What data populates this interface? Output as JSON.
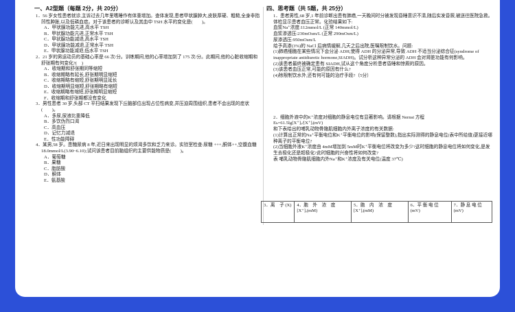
{
  "left": {
    "section_title": "一、A2型题（每题 2分，共 20分）",
    "questions": [
      {
        "stem": "1．56 岁女性患者就诊,主诉过去几年里嗜睡作有体重增加。查体发现,患者甲状腺肿大,皮肤厚硬、粗糙,全身非指凹性肿胀,以及低磷血症。对于该患者的诊断认及其血中 TSH 水平的变化是(　　)。",
        "options": [
          "A．甲状腺功能亢进,高水平 TSH",
          "B．甲状腺功能亢进,正常水平 TSH",
          "C．甲状腺功能减退,高水平 TSH",
          "D．甲状腺功能减退,正常水平 TSH",
          "E．甲状腺功能减退,低水平 TSH"
        ]
      },
      {
        "stem": "2．21 岁的男运动员的基础心率是 66 次/分。训练期间,他的心率增加到了 175 次/分。此期间,他的心脏收缩期和舒张期有何变化?(　)",
        "options": [
          "A．收缩期和舒张期同等缩短",
          "B．收缩期略有延长,舒张期明显缩短",
          "C．收缩期略有缩短,舒张期明显延长",
          "D．收缩期明显缩短,舒张期略有缩短",
          "E．收缩期略有缩短,舒张期明显缩短",
          "F．收缩期和舒张期都没有变化"
        ]
      },
      {
        "stem": "3．男性患者 30 岁,头部 CT 平扫结果发现下丘脑部位出现占位性病变,并压迫周围组织,患者不会出现的症状(　　)。",
        "options": [
          "A．多尿,尿液比重降低",
          "B．多饮伪烈口渴",
          "C．高血压",
          "D．记忆力减退",
          "E．性功能障碍"
        ]
      },
      {
        "stem": "4．某男,58 岁。患糖尿病 8 年,近日来出现明显的烦渴多饮和乏力来诊。实验室检查:尿糖 +++,酮体++,空腹血糖 18.0mmol/L(3.90~6.10);试问该患者目前脑组织的主要供能物质是(　　)。",
        "options": [
          "A．葡萄糖",
          "B．果糖",
          "C．脂肪酸",
          "D．酮体",
          "E．氨基酸"
        ]
      }
    ]
  },
  "right": {
    "section_title": "四、思考题（共 5题，共 25分）",
    "q1": [
      "1．患者男性,68 岁,1 年前诊断出患有肺癌,一天晚间时分被发现昏睡意识不清,随后实发昏厥,被送往医院急救。体检显示患者血压正常。化验结果如下:",
      "血浆Na⁺浓度:112mmol/L (正常 140mmol/L)",
      "血浆渗透压:230mOsm/L (正常 290mOsm/L)",
      "尿渗透压:950mOsm/L",
      "给予高渗(3%)的 NaCl 后病情缓解,几天之后出院,医嘱限制饮水。问题:",
      "(1)肺癌细胞在某些情况下会分泌 ADH,使得 ADH 的分泌异常,导致 ADH 不适当分泌综合征(syndrome of inappropriate antidiuretic hormone,SIADH)。试分析这种异常分泌的 ADH 会对肾脏功能有何影响。",
      "(2)该患者最终被确定患有 SIADH,试从这个角度分析患者昏睡和惊厥的原因。",
      "(3)该患者血压正常,可能的原因有什么?",
      "(4)除限制饮水外,还有何可能的治疗手段?（5分）"
    ],
    "q2": [
      "2．细胞外液中的K⁺浓度对细胞的静息电位有显著影响。请根据 Nernst 方程",
      "Eₖ=61.5lg[X⁺]ₒ/[X⁺]ᵢ(mV)",
      "和下表给出的哺乳动物骨骼肌细胞内外离子浓度的有关数据:",
      "(1)计算出正常的Na⁺平衡电位和K⁺平衡电位的影响(保留整数),指出实际测得的静息电位(表中所给值)更接近哪种离子的平衡电位?",
      "(2)当细胞外液K⁺浓度由 4mM增加到 5mM时K⁺平衡电位将改变为多少?这时细胞的静息电位将如何变化,是发生去极化还是超极化?此时细胞的兴奋性将如何改变?",
      "表 哺乳动物骨骼肌细胞内外Na⁺和K⁺浓度及有关电位(温度 37℃)"
    ],
    "table_headers": [
      "3．离　子 (X)",
      "4．胞　外　浓　度 [X⁺]ₒ(mM)",
      "5．胞　内　浓　度 [X⁺]ᵢ(mM)",
      "6．平 衡 电 位 (mV)",
      "7．静 息 电 位 (mV)"
    ]
  }
}
